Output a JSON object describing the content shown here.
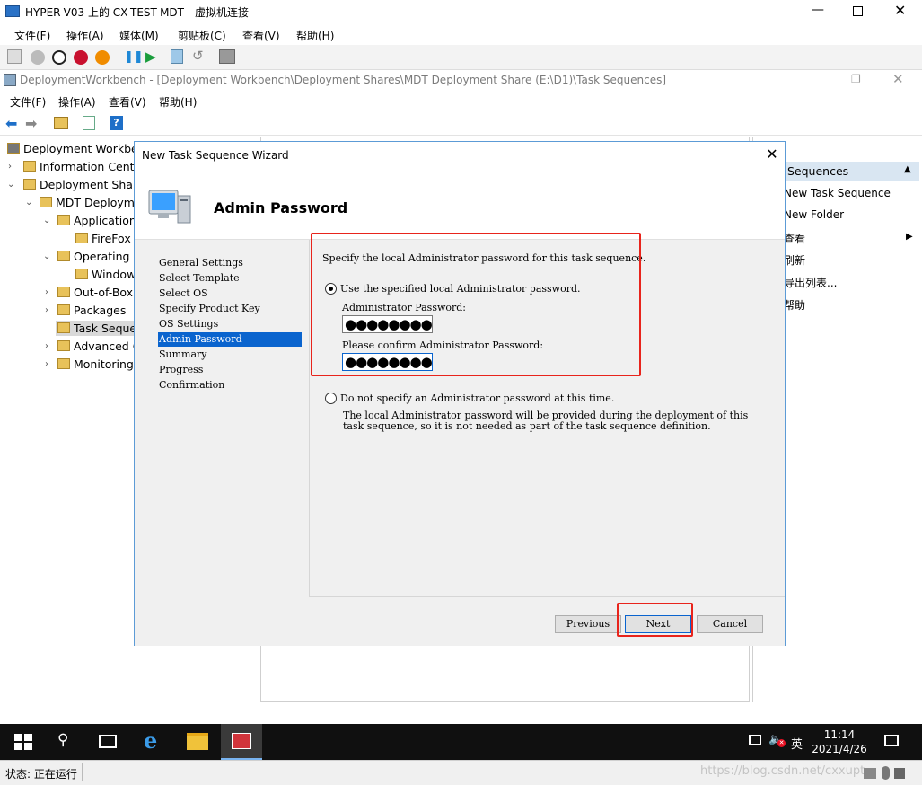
{
  "host": {
    "title": "HYPER-V03 上的 CX-TEST-MDT - 虚拟机连接",
    "menu": [
      "文件(F)",
      "操作(A)",
      "媒体(M)",
      "剪贴板(C)",
      "查看(V)",
      "帮助(H)"
    ]
  },
  "mmc": {
    "title": "DeploymentWorkbench - [Deployment Workbench\\Deployment Shares\\MDT Deployment Share (E:\\D1)\\Task Sequences]",
    "menu": [
      "文件(F)",
      "操作(A)",
      "查看(V)",
      "帮助(H)"
    ]
  },
  "tree": [
    "Deployment Workbe",
    "Information Cente",
    "Deployment Share",
    "MDT Deploym",
    "Application",
    "FireFox",
    "Operating",
    "Window",
    "Out-of-Box",
    "Packages",
    "Task Seque",
    "Advanced C",
    "Monitoring"
  ],
  "actions": {
    "header": "Sequences",
    "items": [
      "New Task Sequence",
      "New Folder",
      "查看",
      "刷新",
      "导出列表...",
      "帮助"
    ]
  },
  "wizard": {
    "title": "New Task Sequence Wizard",
    "heading": "Admin Password",
    "steps": [
      "General Settings",
      "Select Template",
      "Select OS",
      "Specify Product Key",
      "OS Settings",
      "Admin Password",
      "Summary",
      "Progress",
      "Confirmation"
    ],
    "intro": "Specify the local Administrator password for this task sequence.",
    "option_use": "Use the specified local Administrator password.",
    "admin_pw_label": "Administrator Password:",
    "admin_pw_value": "●●●●●●●●●",
    "confirm_pw_label": "Please confirm Administrator Password:",
    "confirm_pw_value": "●●●●●●●●●",
    "option_none": "Do not specify an Administrator password at this time.",
    "option_none_desc_1": "The local Administrator password will be provided during the deployment of this",
    "option_none_desc_2": "task sequence, so it is not needed as part of the task sequence definition.",
    "buttons": {
      "previous": "Previous",
      "next": "Next",
      "cancel": "Cancel"
    }
  },
  "taskbar": {
    "ime": "英",
    "time": "11:14",
    "date": "2021/4/26"
  },
  "statusbar": {
    "text": "状态: 正在运行",
    "watermark": "https://blog.csdn.net/cxxupt"
  }
}
